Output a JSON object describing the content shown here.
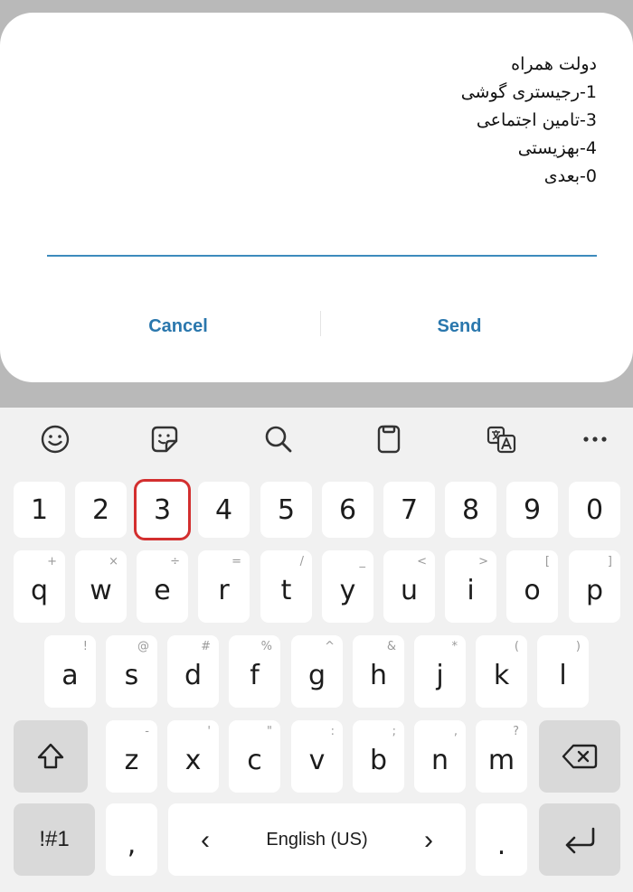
{
  "dialog": {
    "lines": [
      "دولت همراه",
      "1-رجیستری گوشی",
      "3-تامین اجتماعی",
      "4-بهزیستی",
      "0-بعدی"
    ],
    "cancel_label": "Cancel",
    "send_label": "Send"
  },
  "keyboard": {
    "toolbar_icons": [
      "emoji-icon",
      "sticker-icon",
      "search-icon",
      "clipboard-icon",
      "translate-icon",
      "more-icon"
    ],
    "numbers": [
      "1",
      "2",
      "3",
      "4",
      "5",
      "6",
      "7",
      "8",
      "9",
      "0"
    ],
    "highlighted_key": "3",
    "row_q": [
      "q",
      "w",
      "e",
      "r",
      "t",
      "y",
      "u",
      "i",
      "o",
      "p"
    ],
    "row_q_hints": [
      "+",
      "×",
      "÷",
      "=",
      "/",
      "_",
      "<",
      ">",
      "[",
      "]"
    ],
    "row_a": [
      "a",
      "s",
      "d",
      "f",
      "g",
      "h",
      "j",
      "k",
      "l"
    ],
    "row_a_hints": [
      "!",
      "@",
      "#",
      "%",
      "^",
      "&",
      "*",
      "(",
      ")"
    ],
    "row_z": [
      "z",
      "x",
      "c",
      "v",
      "b",
      "n",
      "m"
    ],
    "row_z_hints": [
      "-",
      "'",
      "\"",
      ":",
      ";",
      ",",
      "?"
    ],
    "symbols_label": "!#1",
    "comma_label": ",",
    "space_label": "English (US)",
    "left_arrow": "‹",
    "right_arrow": "›",
    "period_label": "."
  }
}
